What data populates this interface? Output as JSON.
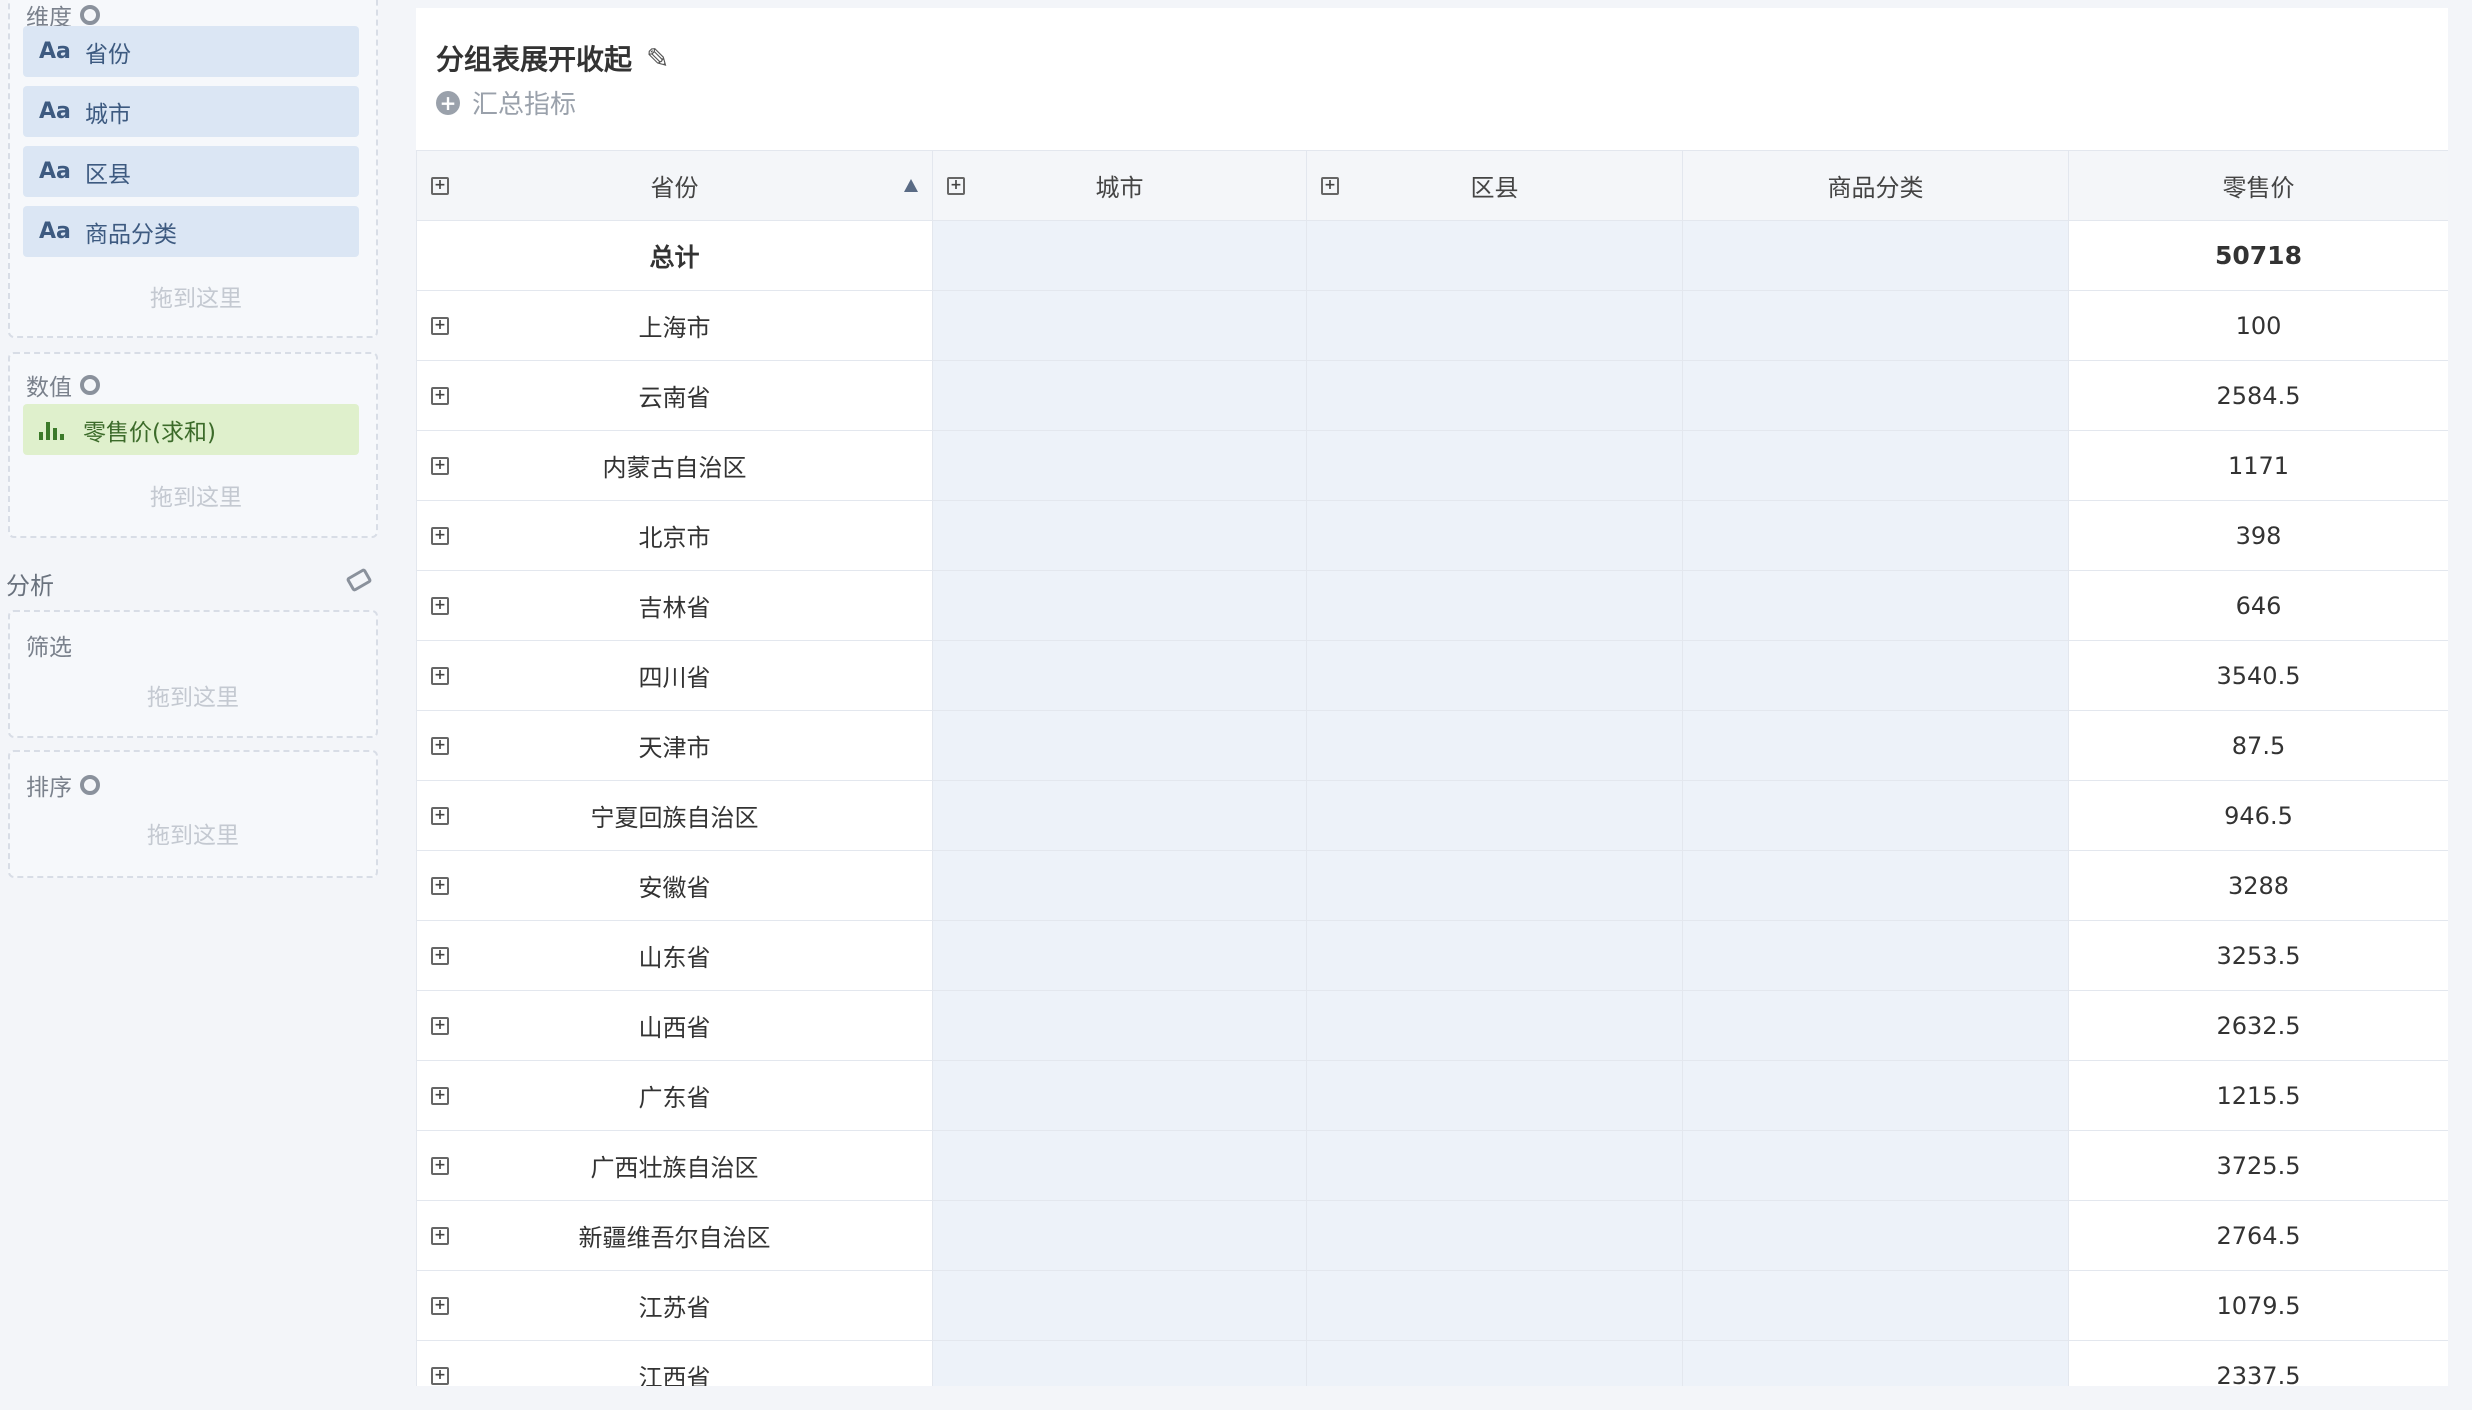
{
  "left_panel": {
    "dimensions": {
      "title": "维度",
      "fields": [
        {
          "icon": "Aa",
          "label": "省份"
        },
        {
          "icon": "Aa",
          "label": "城市"
        },
        {
          "icon": "Aa",
          "label": "区县"
        },
        {
          "icon": "Aa",
          "label": "商品分类"
        }
      ],
      "drop_hint": "拖到这里"
    },
    "measures": {
      "title": "数值",
      "fields": [
        {
          "label": "零售价(求和)"
        }
      ],
      "drop_hint": "拖到这里"
    },
    "analysis": {
      "title": "分析",
      "filter": {
        "title": "筛选",
        "drop_hint": "拖到这里"
      },
      "sort": {
        "title": "排序",
        "drop_hint": "拖到这里"
      }
    }
  },
  "report": {
    "title": "分组表展开收起",
    "add_metric_label": "汇总指标",
    "columns": [
      "省份",
      "城市",
      "区县",
      "商品分类",
      "零售价"
    ],
    "total_row": {
      "label": "总计",
      "value": "50718"
    },
    "rows": [
      {
        "province": "上海市",
        "value": "100"
      },
      {
        "province": "云南省",
        "value": "2584.5"
      },
      {
        "province": "内蒙古自治区",
        "value": "1171"
      },
      {
        "province": "北京市",
        "value": "398"
      },
      {
        "province": "吉林省",
        "value": "646"
      },
      {
        "province": "四川省",
        "value": "3540.5"
      },
      {
        "province": "天津市",
        "value": "87.5"
      },
      {
        "province": "宁夏回族自治区",
        "value": "946.5"
      },
      {
        "province": "安徽省",
        "value": "3288"
      },
      {
        "province": "山东省",
        "value": "3253.5"
      },
      {
        "province": "山西省",
        "value": "2632.5"
      },
      {
        "province": "广东省",
        "value": "1215.5"
      },
      {
        "province": "广西壮族自治区",
        "value": "3725.5"
      },
      {
        "province": "新疆维吾尔自治区",
        "value": "2764.5"
      },
      {
        "province": "江苏省",
        "value": "1079.5"
      },
      {
        "province": "江西省",
        "value": "2337.5"
      }
    ]
  }
}
